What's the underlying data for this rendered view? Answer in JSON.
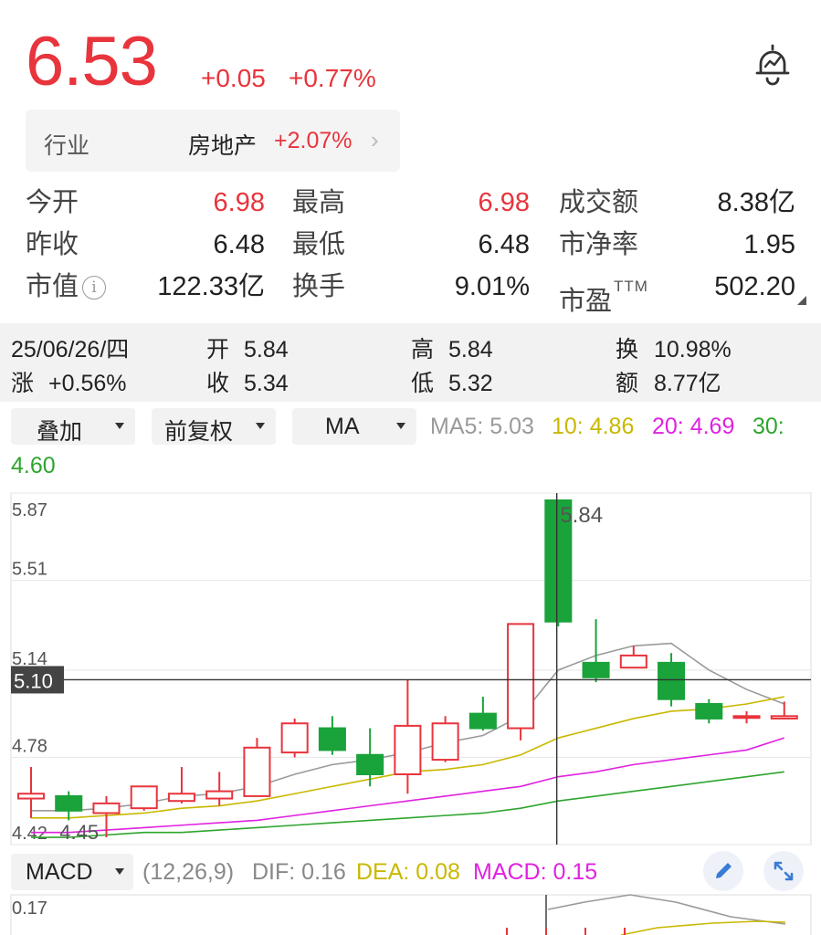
{
  "quote": {
    "price": "6.53",
    "change_abs": "+0.05",
    "change_pct": "+0.77%"
  },
  "industry": {
    "label": "行业",
    "name": "房地产",
    "pct": "+2.07%",
    "chevron": "›"
  },
  "stats": {
    "open_label": "今开",
    "open": "6.98",
    "high_label": "最高",
    "high": "6.98",
    "turnover_label": "成交额",
    "turnover": "8.38亿",
    "prev_close_label": "昨收",
    "prev_close": "6.48",
    "low_label": "最低",
    "low": "6.48",
    "pb_label": "市净率",
    "pb": "1.95",
    "mcap_label": "市值",
    "mcap": "122.33亿",
    "turnover_rate_label": "换手",
    "turnover_rate": "9.01%",
    "pe_label": "市盈",
    "pe_suffix": "TTM",
    "pe": "502.20",
    "info_glyph": "i"
  },
  "day_detail": {
    "date": "25/06/26/四",
    "open_label": "开",
    "open": "5.84",
    "high_label": "高",
    "high": "5.84",
    "rate_label": "换",
    "rate": "10.98%",
    "change_label": "涨",
    "change": "+0.56%",
    "close_label": "收",
    "close": "5.34",
    "low_label": "低",
    "low": "5.32",
    "amount_label": "额",
    "amount": "8.77亿"
  },
  "controls": {
    "overlay": "叠加",
    "adjust": "前复权",
    "indicator": "MA",
    "ma5": "MA5: 5.03",
    "ma10": "10: 4.86",
    "ma20": "20: 4.69",
    "ma30_label": "30:",
    "ma30_value": "4.60"
  },
  "colors": {
    "up": "#e8343c",
    "down": "#1aa33a",
    "ma5": "#9a9a9a",
    "ma10": "#c9b800",
    "ma20": "#e022e0",
    "ma30": "#2ea52e"
  },
  "icons": [
    "bell-icon",
    "info-icon",
    "chevron-right-icon",
    "dropdown-arrow-icon",
    "pencil-icon",
    "expand-icon"
  ],
  "chart_data": {
    "type": "candlestick",
    "y_ticks": [
      "5.87",
      "5.51",
      "5.14",
      "4.78",
      "4.42"
    ],
    "ylim": [
      4.42,
      5.87
    ],
    "crosshair_price": "5.10",
    "crosshair_value": 5.1,
    "crosshair_index": 13,
    "max_label": "5.84",
    "min_label": "4.45",
    "candles": [
      {
        "o": 4.61,
        "c": 4.63,
        "h": 4.74,
        "l": 4.53
      },
      {
        "o": 4.62,
        "c": 4.56,
        "h": 4.64,
        "l": 4.52
      },
      {
        "o": 4.55,
        "c": 4.59,
        "h": 4.62,
        "l": 4.45
      },
      {
        "o": 4.57,
        "c": 4.66,
        "h": 4.66,
        "l": 4.56
      },
      {
        "o": 4.6,
        "c": 4.63,
        "h": 4.74,
        "l": 4.59
      },
      {
        "o": 4.61,
        "c": 4.64,
        "h": 4.72,
        "l": 4.58
      },
      {
        "o": 4.62,
        "c": 4.82,
        "h": 4.86,
        "l": 4.62
      },
      {
        "o": 4.8,
        "c": 4.92,
        "h": 4.94,
        "l": 4.78
      },
      {
        "o": 4.9,
        "c": 4.81,
        "h": 4.95,
        "l": 4.79
      },
      {
        "o": 4.79,
        "c": 4.71,
        "h": 4.9,
        "l": 4.66
      },
      {
        "o": 4.71,
        "c": 4.91,
        "h": 5.1,
        "l": 4.63
      },
      {
        "o": 4.77,
        "c": 4.92,
        "h": 4.95,
        "l": 4.76
      },
      {
        "o": 4.96,
        "c": 4.9,
        "h": 5.03,
        "l": 4.89
      },
      {
        "o": 4.9,
        "c": 5.33,
        "h": 5.33,
        "l": 4.85
      },
      {
        "o": 5.84,
        "c": 5.34,
        "h": 5.84,
        "l": 5.32
      },
      {
        "o": 5.17,
        "c": 5.11,
        "h": 5.35,
        "l": 5.09
      },
      {
        "o": 5.15,
        "c": 5.2,
        "h": 5.24,
        "l": 5.15
      },
      {
        "o": 5.17,
        "c": 5.02,
        "h": 5.21,
        "l": 4.99
      },
      {
        "o": 5.0,
        "c": 4.94,
        "h": 5.02,
        "l": 4.92
      },
      {
        "o": 4.95,
        "c": 4.95,
        "h": 4.97,
        "l": 4.92
      },
      {
        "o": 4.94,
        "c": 4.95,
        "h": 5.01,
        "l": 4.94
      }
    ],
    "ma5": [
      4.56,
      4.56,
      4.57,
      4.59,
      4.62,
      4.63,
      4.66,
      4.71,
      4.75,
      4.77,
      4.8,
      4.84,
      4.87,
      4.95,
      5.14,
      5.2,
      5.24,
      5.25,
      5.14,
      5.06,
      5.0
    ],
    "ma10": [
      4.53,
      4.53,
      4.54,
      4.55,
      4.57,
      4.58,
      4.6,
      4.63,
      4.66,
      4.69,
      4.72,
      4.73,
      4.75,
      4.79,
      4.86,
      4.9,
      4.94,
      4.97,
      4.98,
      5.0,
      5.03
    ],
    "ma20": [
      4.47,
      4.47,
      4.48,
      4.49,
      4.5,
      4.51,
      4.52,
      4.54,
      4.56,
      4.58,
      4.6,
      4.62,
      4.64,
      4.66,
      4.7,
      4.72,
      4.75,
      4.77,
      4.79,
      4.81,
      4.86
    ],
    "ma30": [
      4.45,
      4.45,
      4.46,
      4.47,
      4.47,
      4.48,
      4.49,
      4.5,
      4.51,
      4.52,
      4.53,
      4.54,
      4.55,
      4.57,
      4.6,
      4.62,
      4.64,
      4.66,
      4.68,
      4.7,
      4.72
    ]
  },
  "macd": {
    "label": "MACD",
    "params": "(12,26,9)",
    "dif": "DIF: 0.16",
    "dea": "DEA: 0.08",
    "macd": "MACD: 0.15",
    "top_tick": "0.17"
  }
}
